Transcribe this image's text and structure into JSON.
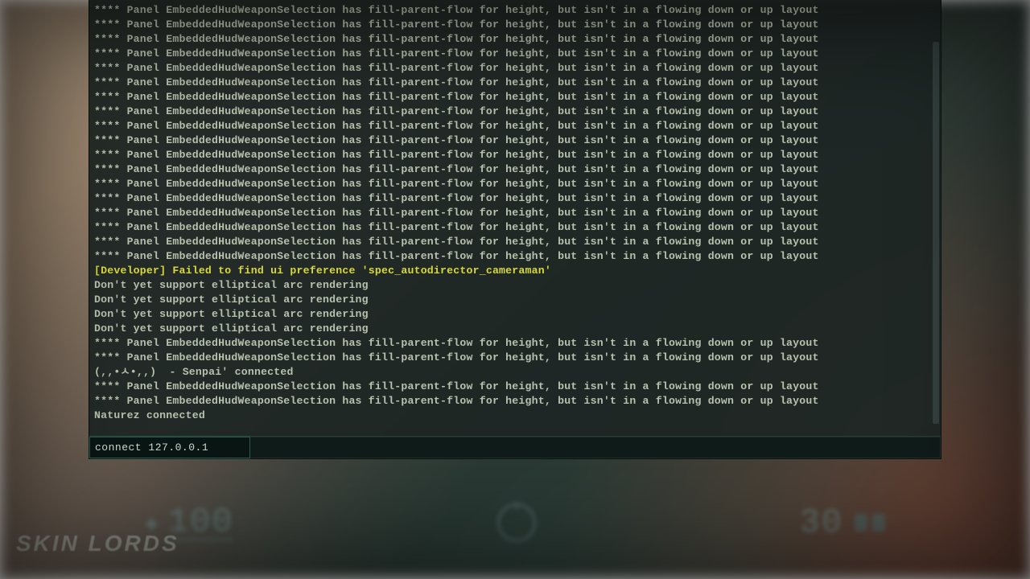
{
  "watermark": "Skin Lords",
  "hud": {
    "health": "100",
    "ammo": "30"
  },
  "console": {
    "input_value": "connect 127.0.0.1",
    "log": [
      {
        "t": "**** Panel EmbeddedHudWeaponSelection has fill-parent-flow for height, but isn't in a flowing down or up layout",
        "c": ""
      },
      {
        "t": "**** Panel EmbeddedHudWeaponSelection has fill-parent-flow for height, but isn't in a flowing down or up layout",
        "c": ""
      },
      {
        "t": "**** Panel EmbeddedHudWeaponSelection has fill-parent-flow for height, but isn't in a flowing down or up layout",
        "c": ""
      },
      {
        "t": "**** Panel EmbeddedHudWeaponSelection has fill-parent-flow for height, but isn't in a flowing down or up layout",
        "c": ""
      },
      {
        "t": "**** Panel EmbeddedHudWeaponSelection has fill-parent-flow for height, but isn't in a flowing down or up layout",
        "c": ""
      },
      {
        "t": "**** Panel EmbeddedHudWeaponSelection has fill-parent-flow for height, but isn't in a flowing down or up layout",
        "c": ""
      },
      {
        "t": "**** Panel EmbeddedHudWeaponSelection has fill-parent-flow for height, but isn't in a flowing down or up layout",
        "c": ""
      },
      {
        "t": "**** Panel EmbeddedHudWeaponSelection has fill-parent-flow for height, but isn't in a flowing down or up layout",
        "c": ""
      },
      {
        "t": "**** Panel EmbeddedHudWeaponSelection has fill-parent-flow for height, but isn't in a flowing down or up layout",
        "c": ""
      },
      {
        "t": "**** Panel EmbeddedHudWeaponSelection has fill-parent-flow for height, but isn't in a flowing down or up layout",
        "c": ""
      },
      {
        "t": "**** Panel EmbeddedHudWeaponSelection has fill-parent-flow for height, but isn't in a flowing down or up layout",
        "c": ""
      },
      {
        "t": "**** Panel EmbeddedHudWeaponSelection has fill-parent-flow for height, but isn't in a flowing down or up layout",
        "c": ""
      },
      {
        "t": "**** Panel EmbeddedHudWeaponSelection has fill-parent-flow for height, but isn't in a flowing down or up layout",
        "c": ""
      },
      {
        "t": "**** Panel EmbeddedHudWeaponSelection has fill-parent-flow for height, but isn't in a flowing down or up layout",
        "c": ""
      },
      {
        "t": "**** Panel EmbeddedHudWeaponSelection has fill-parent-flow for height, but isn't in a flowing down or up layout",
        "c": ""
      },
      {
        "t": "**** Panel EmbeddedHudWeaponSelection has fill-parent-flow for height, but isn't in a flowing down or up layout",
        "c": ""
      },
      {
        "t": "**** Panel EmbeddedHudWeaponSelection has fill-parent-flow for height, but isn't in a flowing down or up layout",
        "c": ""
      },
      {
        "t": "**** Panel EmbeddedHudWeaponSelection has fill-parent-flow for height, but isn't in a flowing down or up layout",
        "c": ""
      },
      {
        "t": "[Developer] Failed to find ui preference 'spec_autodirector_cameraman'",
        "c": "warn"
      },
      {
        "t": "Don't yet support elliptical arc rendering",
        "c": ""
      },
      {
        "t": "Don't yet support elliptical arc rendering",
        "c": ""
      },
      {
        "t": "Don't yet support elliptical arc rendering",
        "c": ""
      },
      {
        "t": "Don't yet support elliptical arc rendering",
        "c": ""
      },
      {
        "t": "**** Panel EmbeddedHudWeaponSelection has fill-parent-flow for height, but isn't in a flowing down or up layout",
        "c": ""
      },
      {
        "t": "**** Panel EmbeddedHudWeaponSelection has fill-parent-flow for height, but isn't in a flowing down or up layout",
        "c": ""
      },
      {
        "t": "(,,•ㅅ•,,)  - Senpai' connected",
        "c": ""
      },
      {
        "t": "**** Panel EmbeddedHudWeaponSelection has fill-parent-flow for height, but isn't in a flowing down or up layout",
        "c": ""
      },
      {
        "t": "**** Panel EmbeddedHudWeaponSelection has fill-parent-flow for height, but isn't in a flowing down or up layout",
        "c": ""
      },
      {
        "t": "Naturez connected",
        "c": ""
      }
    ]
  }
}
